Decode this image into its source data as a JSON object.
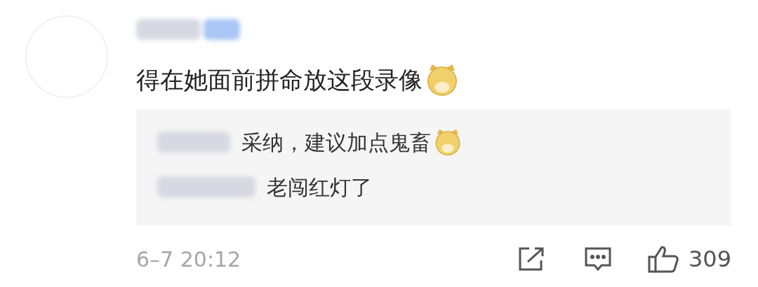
{
  "comment": {
    "author_blurred": true,
    "text": "得在她面前拼命放这段录像",
    "ends_with_emoji": true
  },
  "replies": [
    {
      "text": "采纳，建议加点鬼畜",
      "ends_with_emoji": true
    },
    {
      "text": "老闯红灯了",
      "ends_with_emoji": false
    }
  ],
  "footer": {
    "time": "6–7 20:12",
    "likes": "309"
  }
}
